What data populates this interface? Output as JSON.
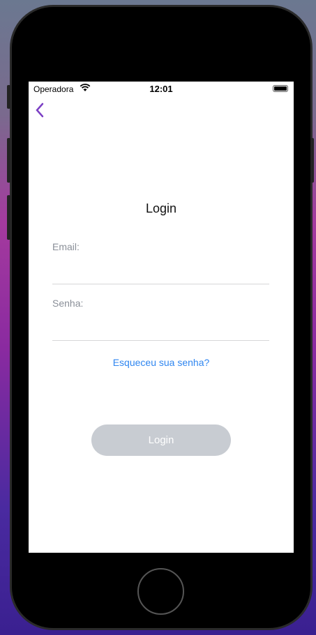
{
  "status_bar": {
    "carrier": "Operadora",
    "time": "12:01"
  },
  "nav": {
    "back_icon": "chevron-left-icon",
    "accent": "#7b3fc4"
  },
  "page": {
    "title": "Login"
  },
  "form": {
    "email_label": "Email:",
    "email_value": "",
    "password_label": "Senha:",
    "password_value": "",
    "forgot_link": "Esqueceu sua senha?",
    "login_button": "Login"
  }
}
